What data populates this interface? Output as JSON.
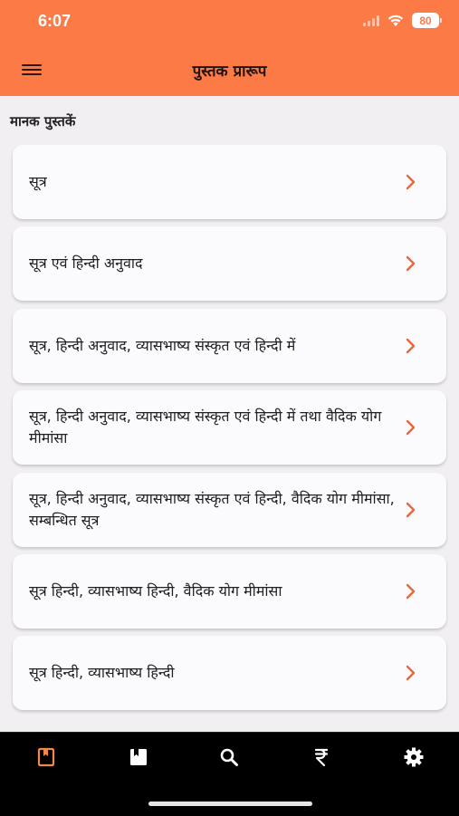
{
  "status_bar": {
    "time": "6:07",
    "battery": "80"
  },
  "header": {
    "title": "पुस्तक प्रारूप"
  },
  "section": {
    "title": "मानक पुस्तकें"
  },
  "list": {
    "items": [
      {
        "label": "सूत्र"
      },
      {
        "label": "सूत्र एवं हिन्दी अनुवाद"
      },
      {
        "label": "सूत्र, हिन्दी अनुवाद, व्यासभाष्य संस्कृत एवं हिन्दी में"
      },
      {
        "label": "सूत्र, हिन्दी अनुवाद, व्यासभाष्य संस्कृत एवं हिन्दी में तथा वैदिक योग मीमांसा"
      },
      {
        "label": "सूत्र, हिन्दी अनुवाद, व्यासभाष्य संस्कृत एवं हिन्दी, वैदिक योग मीमांसा, सम्बन्धित सूत्र"
      },
      {
        "label": "सूत्र हिन्दी, व्यासभाष्य हिन्दी, वैदिक योग मीमांसा"
      },
      {
        "label": "सूत्र हिन्दी, व्यासभाष्य हिन्दी"
      }
    ]
  },
  "tab_bar": {
    "tabs": [
      {
        "icon": "book-icon",
        "active": true
      },
      {
        "icon": "bookmark-icon",
        "active": false
      },
      {
        "icon": "search-icon",
        "active": false
      },
      {
        "icon": "rupee-icon",
        "active": false
      },
      {
        "icon": "gear-icon",
        "active": false
      }
    ]
  },
  "colors": {
    "accent": "#fb7a45",
    "chevron": "#e8683c",
    "background": "#f2eff3",
    "tab_active": "#f08a4b",
    "tab_bar": "#000000"
  }
}
